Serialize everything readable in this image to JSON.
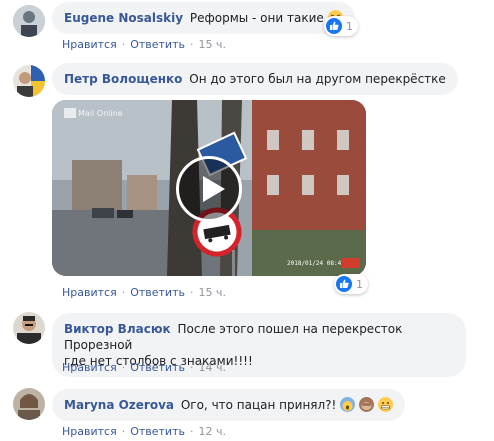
{
  "actions": {
    "like": "Нравится",
    "reply": "Ответить",
    "separator": "·"
  },
  "comments": [
    {
      "author": "Eugene Nosalskiy",
      "text": "Реформы - они такие",
      "time": "15 ч.",
      "reactions": "1"
    },
    {
      "author": "Петр Волощенко",
      "text": "Он до этого был на другом перекрёстке",
      "time": "15 ч.",
      "reactions": "1",
      "video": {
        "watermark": "Mail Online",
        "timestamp": "2018/01/24 08:41:13",
        "sign_icon": "no-trucks-sign-icon"
      }
    },
    {
      "author": "Виктор Власюк",
      "text_line1": "После этого пошел на перекресток Прорезной",
      "text_line2": "где нет столбов с знаками!!!!",
      "time": "14 ч."
    },
    {
      "author": "Maryna Ozerova",
      "text": "Ого, что пацан принял?!",
      "time": "12 ч."
    }
  ],
  "colors": {
    "author": "#385898",
    "bubble": "#f2f3f5",
    "meta": "#90949c",
    "like": "#1877f2"
  }
}
